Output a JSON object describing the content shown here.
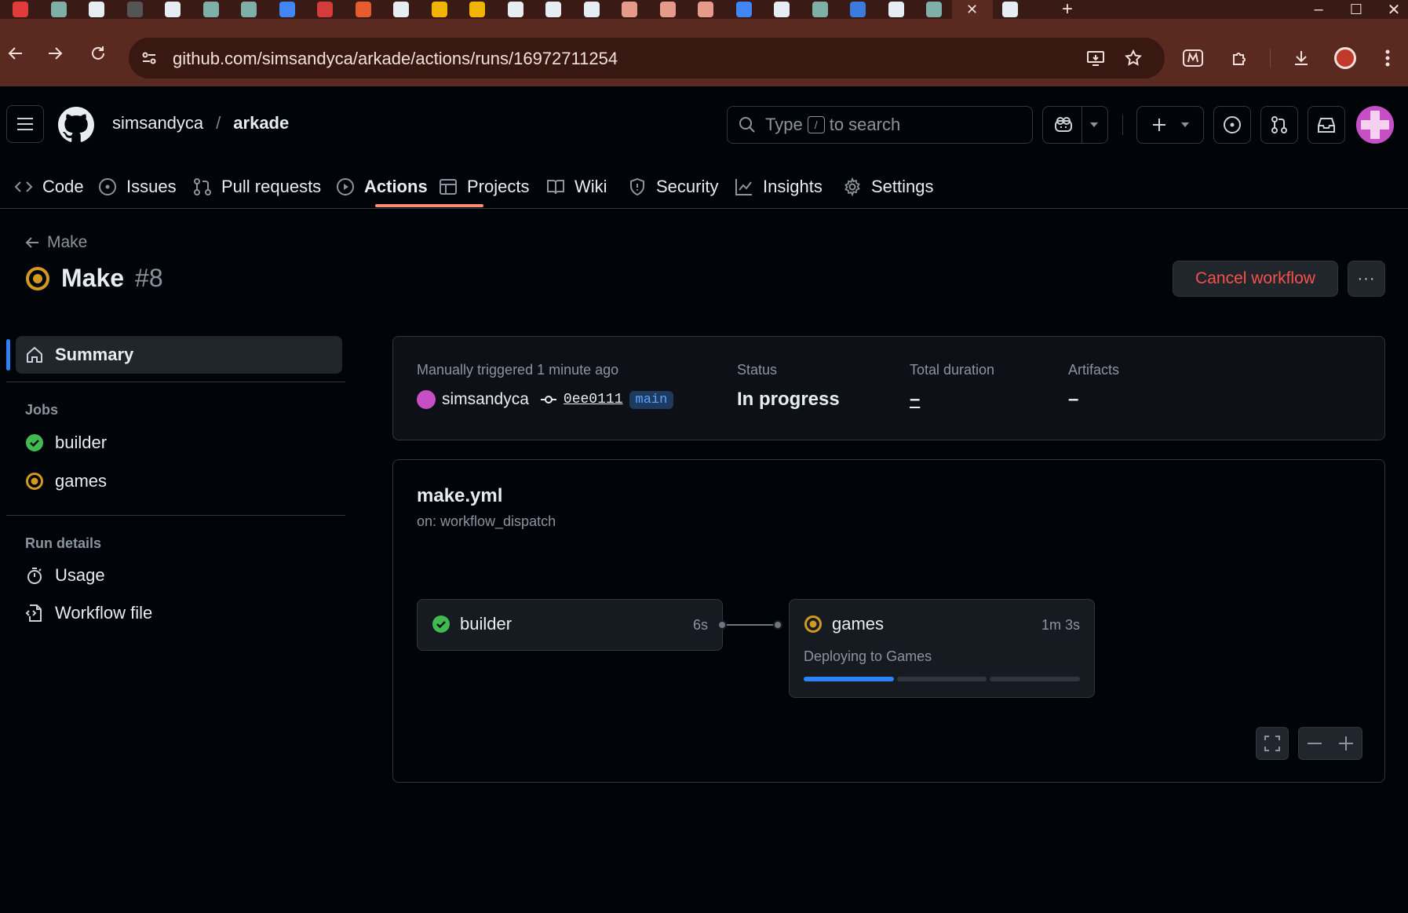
{
  "browser": {
    "url": "github.com/simsandyca/arkade/actions/runs/16972711254",
    "tab_close": "✕",
    "new_tab": "+",
    "window_controls": [
      "–",
      "☐",
      "✕"
    ],
    "favicon_colors": [
      "#e03a3a",
      "#7fb0a8",
      "#e6edf3",
      "#555555",
      "#e6edf3",
      "#7fb0a8",
      "#7fb0a8",
      "#4285f4",
      "#d43c3c",
      "#e65c2e",
      "#e6edf3",
      "#f0b400",
      "#f0b400",
      "#e6edf3",
      "#e6edf3",
      "#e6edf3",
      "#e69a8a",
      "#e69a8a",
      "#e69a8a",
      "#4285f4",
      "#e6edf3",
      "#7fb0a8",
      "#3a7be0",
      "#e6edf3",
      "#7fb0a8",
      "#e6edf3"
    ]
  },
  "header": {
    "owner": "simsandyca",
    "separator": "/",
    "repo": "arkade",
    "search_prefix": "Type",
    "search_key": "/",
    "search_suffix": "to search"
  },
  "repo_nav": {
    "tabs": [
      {
        "label": "Code",
        "icon": "code-icon"
      },
      {
        "label": "Issues",
        "icon": "issue-icon"
      },
      {
        "label": "Pull requests",
        "icon": "pull-request-icon"
      },
      {
        "label": "Actions",
        "icon": "play-icon",
        "selected": true
      },
      {
        "label": "Projects",
        "icon": "table-icon"
      },
      {
        "label": "Wiki",
        "icon": "book-icon"
      },
      {
        "label": "Security",
        "icon": "shield-icon"
      },
      {
        "label": "Insights",
        "icon": "graph-icon"
      },
      {
        "label": "Settings",
        "icon": "gear-icon"
      }
    ]
  },
  "run": {
    "back_label": "Make",
    "title": "Make",
    "number": "#8",
    "cancel_label": "Cancel workflow",
    "more_label": "···"
  },
  "sidebar": {
    "summary_label": "Summary",
    "jobs_heading": "Jobs",
    "jobs": [
      {
        "label": "builder",
        "status": "success"
      },
      {
        "label": "games",
        "status": "in-progress"
      }
    ],
    "run_details_heading": "Run details",
    "run_details": [
      {
        "label": "Usage",
        "icon": "stopwatch-icon"
      },
      {
        "label": "Workflow file",
        "icon": "file-code-icon"
      }
    ]
  },
  "summary": {
    "trigger_label": "Manually triggered 1 minute ago",
    "actor": "simsandyca",
    "commit": "0ee0111",
    "branch": "main",
    "status_label": "Status",
    "status_value": "In progress",
    "duration_label": "Total duration",
    "duration_value": "–",
    "artifacts_label": "Artifacts",
    "artifacts_value": "–"
  },
  "workflow": {
    "file": "make.yml",
    "trigger": "on: workflow_dispatch",
    "jobs": [
      {
        "name": "builder",
        "time": "6s",
        "status": "success"
      },
      {
        "name": "games",
        "time": "1m 3s",
        "status": "in-progress",
        "step": "Deploying to Games",
        "progress_segments": [
          1,
          0,
          0
        ]
      }
    ]
  },
  "colors": {
    "success": "#3fb950",
    "in_progress": "#d29922",
    "accent": "#2f81f7",
    "danger": "#f85149",
    "tab_underline": "#fd8c73"
  }
}
